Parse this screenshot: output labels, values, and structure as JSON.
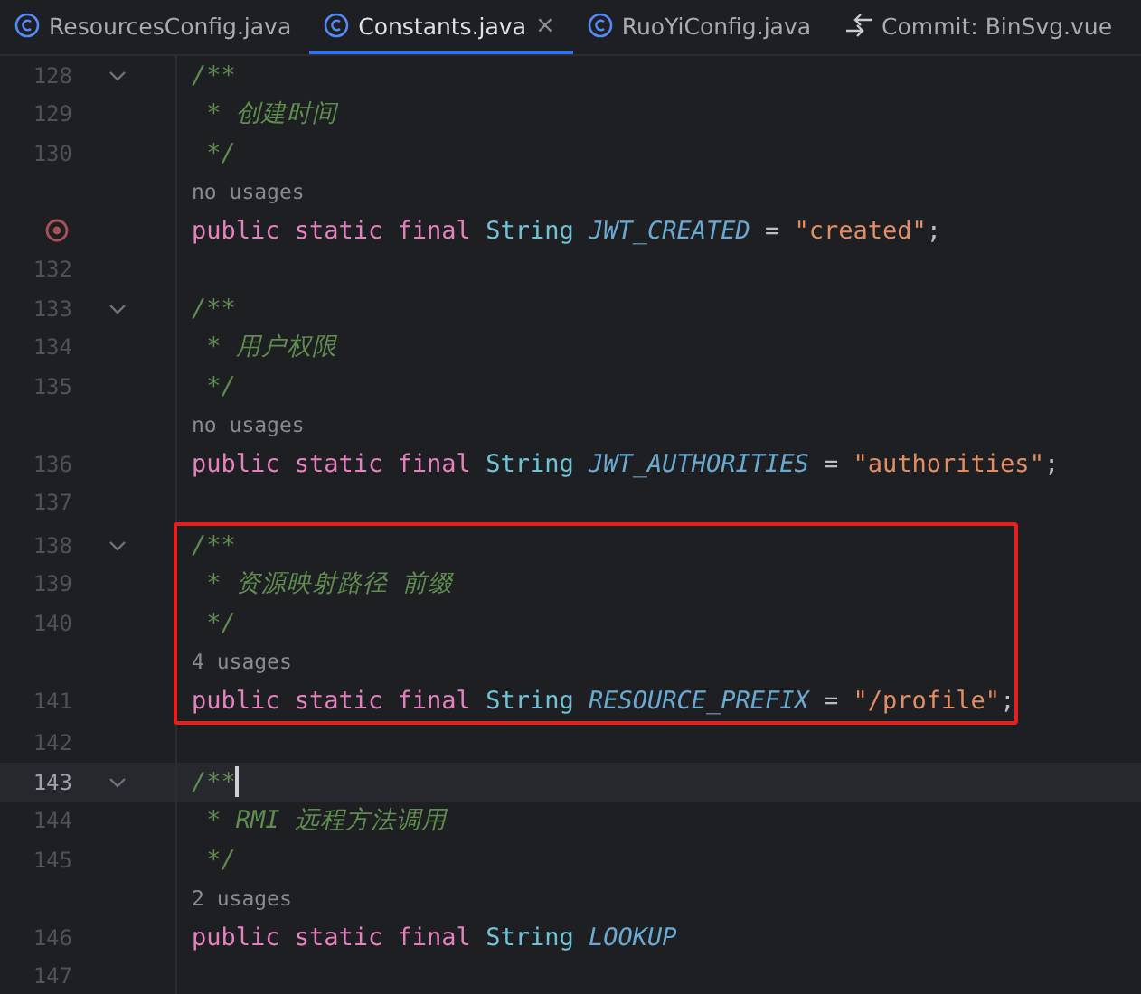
{
  "tabs": [
    {
      "label": "ResourcesConfig.java",
      "kind": "class",
      "selected": false
    },
    {
      "label": "Constants.java",
      "kind": "class",
      "selected": true,
      "close": "×"
    },
    {
      "label": "RuoYiConfig.java",
      "kind": "class",
      "selected": false
    },
    {
      "label": "Commit: BinSvg.vue",
      "kind": "commit",
      "selected": false
    }
  ],
  "blocks": [
    {
      "highlighted": false,
      "lines": [
        {
          "number": "128",
          "kind": "code",
          "fold": true,
          "tokens": [
            {
              "kind": "comment",
              "text": "/**"
            }
          ]
        },
        {
          "number": "129",
          "kind": "code",
          "tokens": [
            {
              "kind": "comment",
              "text": " * 创建时间"
            }
          ]
        },
        {
          "number": "130",
          "kind": "code",
          "tokens": [
            {
              "kind": "comment",
              "text": " */"
            }
          ]
        },
        {
          "kind": "inlay",
          "text": "no usages"
        },
        {
          "watched": true,
          "kind": "code",
          "tokens": [
            {
              "kind": "keyword",
              "text": "public static final "
            },
            {
              "kind": "type",
              "text": "String "
            },
            {
              "kind": "const",
              "text": "JWT_CREATED"
            },
            {
              "kind": "plain",
              "text": " = "
            },
            {
              "kind": "string",
              "text": "\"created\""
            },
            {
              "kind": "plain",
              "text": ";"
            }
          ]
        },
        {
          "number": "132",
          "kind": "code"
        },
        {
          "number": "133",
          "kind": "code",
          "fold": true,
          "tokens": [
            {
              "kind": "comment",
              "text": "/**"
            }
          ]
        },
        {
          "number": "134",
          "kind": "code",
          "tokens": [
            {
              "kind": "comment",
              "text": " * 用户权限"
            }
          ]
        },
        {
          "number": "135",
          "kind": "code",
          "tokens": [
            {
              "kind": "comment",
              "text": " */"
            }
          ]
        },
        {
          "kind": "inlay",
          "text": "no usages"
        },
        {
          "number": "136",
          "kind": "code",
          "tokens": [
            {
              "kind": "keyword",
              "text": "public static final "
            },
            {
              "kind": "type",
              "text": "String "
            },
            {
              "kind": "const",
              "text": "JWT_AUTHORITIES"
            },
            {
              "kind": "plain",
              "text": " = "
            },
            {
              "kind": "string",
              "text": "\"authorities\""
            },
            {
              "kind": "plain",
              "text": ";"
            }
          ]
        },
        {
          "number": "137",
          "kind": "code"
        }
      ]
    },
    {
      "highlighted": true,
      "lines": [
        {
          "number": "138",
          "kind": "code",
          "fold": true,
          "tokens": [
            {
              "kind": "comment",
              "text": "/**"
            }
          ]
        },
        {
          "number": "139",
          "kind": "code",
          "tokens": [
            {
              "kind": "comment",
              "text": " * 资源映射路径 前缀"
            }
          ]
        },
        {
          "number": "140",
          "kind": "code",
          "tokens": [
            {
              "kind": "comment",
              "text": " */"
            }
          ]
        },
        {
          "kind": "inlay",
          "text": "4 usages"
        },
        {
          "number": "141",
          "kind": "code",
          "tokens": [
            {
              "kind": "keyword",
              "text": "public static final "
            },
            {
              "kind": "type",
              "text": "String "
            },
            {
              "kind": "const",
              "text": "RESOURCE_PREFIX"
            },
            {
              "kind": "plain",
              "text": " = "
            },
            {
              "kind": "string",
              "text": "\"/profile\""
            },
            {
              "kind": "plain",
              "text": ";"
            }
          ]
        }
      ]
    },
    {
      "highlighted": false,
      "lines": [
        {
          "number": "142",
          "kind": "code"
        },
        {
          "number": "143",
          "kind": "code",
          "fold": true,
          "current": true,
          "tokens": [
            {
              "kind": "comment",
              "text": "/**"
            }
          ]
        },
        {
          "number": "144",
          "kind": "code",
          "tokens": [
            {
              "kind": "comment",
              "text": " * RMI 远程方法调用"
            }
          ]
        },
        {
          "number": "145",
          "kind": "code",
          "tokens": [
            {
              "kind": "comment",
              "text": " */"
            }
          ]
        },
        {
          "kind": "inlay",
          "text": "2 usages"
        },
        {
          "number": "146",
          "kind": "code",
          "tokens": [
            {
              "kind": "keyword",
              "text": "public static final "
            },
            {
              "kind": "type",
              "text": "String "
            },
            {
              "kind": "const",
              "text": "LOOKUP"
            }
          ]
        },
        {
          "number": "147",
          "kind": "code"
        }
      ]
    }
  ]
}
